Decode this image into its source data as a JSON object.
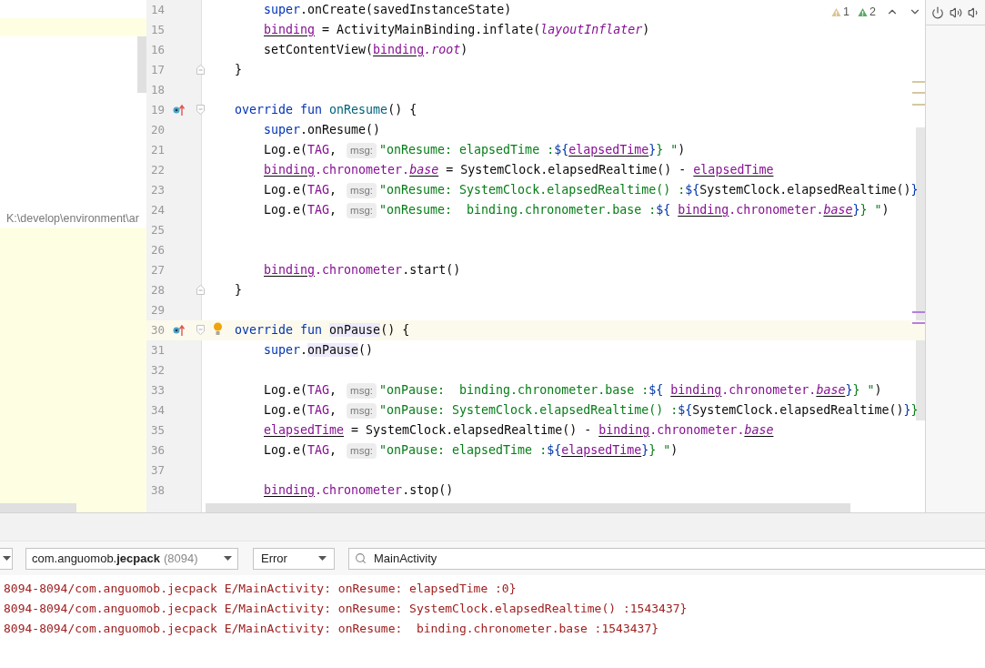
{
  "left_panel": {
    "path_text": "K:\\develop\\environment\\ar"
  },
  "inspections": {
    "warnings": "1",
    "weak_warnings": "2"
  },
  "editor": {
    "lines": [
      {
        "number": "14",
        "current": false,
        "kind": "body",
        "tokens": [
          {
            "kind": "kw",
            "text": "super"
          },
          {
            "kind": "plain",
            "text": ".onCreate(savedInstanceState)"
          }
        ]
      },
      {
        "number": "15",
        "current": false,
        "kind": "body",
        "tokens": [
          {
            "kind": "var",
            "text": "binding"
          },
          {
            "kind": "plain",
            "text": " = ActivityMainBinding.inflate("
          },
          {
            "kind": "italic",
            "text": "layoutInflater"
          },
          {
            "kind": "plain",
            "text": ")"
          }
        ]
      },
      {
        "number": "16",
        "current": false,
        "kind": "body",
        "tokens": [
          {
            "kind": "plain",
            "text": "setContentView("
          },
          {
            "kind": "var",
            "text": "binding"
          },
          {
            "kind": "italic",
            "text": ".root"
          },
          {
            "kind": "plain",
            "text": ")"
          }
        ]
      },
      {
        "number": "17",
        "current": false,
        "kind": "member",
        "gutter": [
          {
            "kind": "fold_end"
          }
        ],
        "tokens": [
          {
            "kind": "plain",
            "text": "}"
          }
        ]
      },
      {
        "number": "18",
        "current": false
      },
      {
        "number": "19",
        "current": false,
        "kind": "member",
        "gutter": [
          {
            "kind": "override"
          },
          {
            "kind": "fold_start"
          }
        ],
        "tokens": [
          {
            "kind": "kw",
            "text": "override fun "
          },
          {
            "kind": "fn",
            "text": "onResume"
          },
          {
            "kind": "plain",
            "text": "() {"
          }
        ]
      },
      {
        "number": "20",
        "current": false,
        "kind": "body",
        "tokens": [
          {
            "kind": "kw",
            "text": "super"
          },
          {
            "kind": "plain",
            "text": ".onResume()"
          }
        ]
      },
      {
        "number": "21",
        "current": false,
        "kind": "body",
        "tokens": [
          {
            "kind": "plain",
            "text": "Log.e("
          },
          {
            "kind": "field",
            "text": "TAG"
          },
          {
            "kind": "plain",
            "text": ", "
          },
          {
            "kind": "hint",
            "text": "msg:"
          },
          {
            "kind": "str",
            "text": "\"onResume: elapsedTime :"
          },
          {
            "kind": "tpl",
            "text": "${"
          },
          {
            "kind": "var",
            "text": "elapsedTime"
          },
          {
            "kind": "tpl",
            "text": "}"
          },
          {
            "kind": "str",
            "text": "} \""
          },
          {
            "kind": "plain",
            "text": ")"
          }
        ]
      },
      {
        "number": "22",
        "current": false,
        "kind": "body",
        "tokens": [
          {
            "kind": "var",
            "text": "binding"
          },
          {
            "kind": "field",
            "text": ".chronometer."
          },
          {
            "kind": "var_italic",
            "text": "base"
          },
          {
            "kind": "plain",
            "text": " = SystemClock.elapsedRealtime() - "
          },
          {
            "kind": "var",
            "text": "elapsedTime"
          }
        ]
      },
      {
        "number": "23",
        "current": false,
        "kind": "body",
        "tokens": [
          {
            "kind": "plain",
            "text": "Log.e("
          },
          {
            "kind": "field",
            "text": "TAG"
          },
          {
            "kind": "plain",
            "text": ", "
          },
          {
            "kind": "hint",
            "text": "msg:"
          },
          {
            "kind": "str",
            "text": "\"onResume: SystemClock.elapsedRealtime() :"
          },
          {
            "kind": "tpl",
            "text": "${"
          },
          {
            "kind": "plain",
            "text": "SystemClock.elapsedRealtime()"
          },
          {
            "kind": "tpl",
            "text": "}"
          }
        ]
      },
      {
        "number": "24",
        "current": false,
        "kind": "body",
        "tokens": [
          {
            "kind": "plain",
            "text": "Log.e("
          },
          {
            "kind": "field",
            "text": "TAG"
          },
          {
            "kind": "plain",
            "text": ", "
          },
          {
            "kind": "hint",
            "text": "msg:"
          },
          {
            "kind": "str",
            "text": "\"onResume:  binding.chronometer.base :"
          },
          {
            "kind": "tpl",
            "text": "${ "
          },
          {
            "kind": "var",
            "text": "binding"
          },
          {
            "kind": "field",
            "text": ".chronometer."
          },
          {
            "kind": "var_italic",
            "text": "base"
          },
          {
            "kind": "tpl",
            "text": "}"
          },
          {
            "kind": "str",
            "text": "} \""
          },
          {
            "kind": "plain",
            "text": ")"
          }
        ]
      },
      {
        "number": "25",
        "current": false
      },
      {
        "number": "26",
        "current": false
      },
      {
        "number": "27",
        "current": false,
        "kind": "body",
        "tokens": [
          {
            "kind": "var",
            "text": "binding"
          },
          {
            "kind": "field",
            "text": ".chronometer"
          },
          {
            "kind": "plain",
            "text": ".start()"
          }
        ]
      },
      {
        "number": "28",
        "current": false,
        "kind": "member",
        "gutter": [
          {
            "kind": "fold_end"
          }
        ],
        "tokens": [
          {
            "kind": "plain",
            "text": "}"
          }
        ]
      },
      {
        "number": "29",
        "current": false
      },
      {
        "number": "30",
        "current": true,
        "kind": "member",
        "gutter": [
          {
            "kind": "override"
          },
          {
            "kind": "fold_start"
          },
          {
            "kind": "bulb"
          }
        ],
        "tokens": [
          {
            "kind": "kw",
            "text": "override fun "
          },
          {
            "kind": "match",
            "text": "onPause"
          },
          {
            "kind": "plain",
            "text": "() {"
          }
        ]
      },
      {
        "number": "31",
        "current": false,
        "kind": "body",
        "tokens": [
          {
            "kind": "kw",
            "text": "super"
          },
          {
            "kind": "plain",
            "text": "."
          },
          {
            "kind": "match",
            "text": "onPause"
          },
          {
            "kind": "plain",
            "text": "()"
          }
        ]
      },
      {
        "number": "32",
        "current": false
      },
      {
        "number": "33",
        "current": false,
        "kind": "body",
        "tokens": [
          {
            "kind": "plain",
            "text": "Log.e("
          },
          {
            "kind": "field",
            "text": "TAG"
          },
          {
            "kind": "plain",
            "text": ", "
          },
          {
            "kind": "hint",
            "text": "msg:"
          },
          {
            "kind": "str",
            "text": "\"onPause:  binding.chronometer.base :"
          },
          {
            "kind": "tpl",
            "text": "${ "
          },
          {
            "kind": "var",
            "text": "binding"
          },
          {
            "kind": "field",
            "text": ".chronometer."
          },
          {
            "kind": "var_italic",
            "text": "base"
          },
          {
            "kind": "tpl",
            "text": "}"
          },
          {
            "kind": "str",
            "text": "} \""
          },
          {
            "kind": "plain",
            "text": ")"
          }
        ]
      },
      {
        "number": "34",
        "current": false,
        "kind": "body",
        "tokens": [
          {
            "kind": "plain",
            "text": "Log.e("
          },
          {
            "kind": "field",
            "text": "TAG"
          },
          {
            "kind": "plain",
            "text": ", "
          },
          {
            "kind": "hint",
            "text": "msg:"
          },
          {
            "kind": "str",
            "text": "\"onPause: SystemClock.elapsedRealtime() :"
          },
          {
            "kind": "tpl",
            "text": "${"
          },
          {
            "kind": "plain",
            "text": "SystemClock.elapsedRealtime()"
          },
          {
            "kind": "tpl",
            "text": "}"
          },
          {
            "kind": "str",
            "text": "}"
          }
        ]
      },
      {
        "number": "35",
        "current": false,
        "kind": "body",
        "tokens": [
          {
            "kind": "var",
            "text": "elapsedTime"
          },
          {
            "kind": "plain",
            "text": " = SystemClock.elapsedRealtime() - "
          },
          {
            "kind": "var",
            "text": "binding"
          },
          {
            "kind": "field",
            "text": ".chronometer."
          },
          {
            "kind": "var_italic",
            "text": "base"
          }
        ]
      },
      {
        "number": "36",
        "current": false,
        "kind": "body",
        "tokens": [
          {
            "kind": "plain",
            "text": "Log.e("
          },
          {
            "kind": "field",
            "text": "TAG"
          },
          {
            "kind": "plain",
            "text": ", "
          },
          {
            "kind": "hint",
            "text": "msg:"
          },
          {
            "kind": "str",
            "text": "\"onPause: elapsedTime :"
          },
          {
            "kind": "tpl",
            "text": "${"
          },
          {
            "kind": "var",
            "text": "elapsedTime"
          },
          {
            "kind": "tpl",
            "text": "}"
          },
          {
            "kind": "str",
            "text": "} \""
          },
          {
            "kind": "plain",
            "text": ")"
          }
        ]
      },
      {
        "number": "37",
        "current": false
      },
      {
        "number": "38",
        "current": false,
        "kind": "body",
        "tokens": [
          {
            "kind": "var",
            "text": "binding"
          },
          {
            "kind": "field",
            "text": ".chronometer"
          },
          {
            "kind": "plain",
            "text": ".stop()"
          }
        ]
      }
    ]
  },
  "logcat": {
    "process": {
      "name": "com.anguomob.**jecpack**",
      "pid": "(8094)"
    },
    "level": "Error",
    "search": "MainActivity",
    "entries": [
      "8094-8094/com.anguomob.jecpack E/MainActivity: onResume: elapsedTime :0}",
      "8094-8094/com.anguomob.jecpack E/MainActivity: onResume: SystemClock.elapsedRealtime() :1543437}",
      "8094-8094/com.anguomob.jecpack E/MainActivity: onResume:  binding.chronometer.base :1543437}"
    ]
  }
}
